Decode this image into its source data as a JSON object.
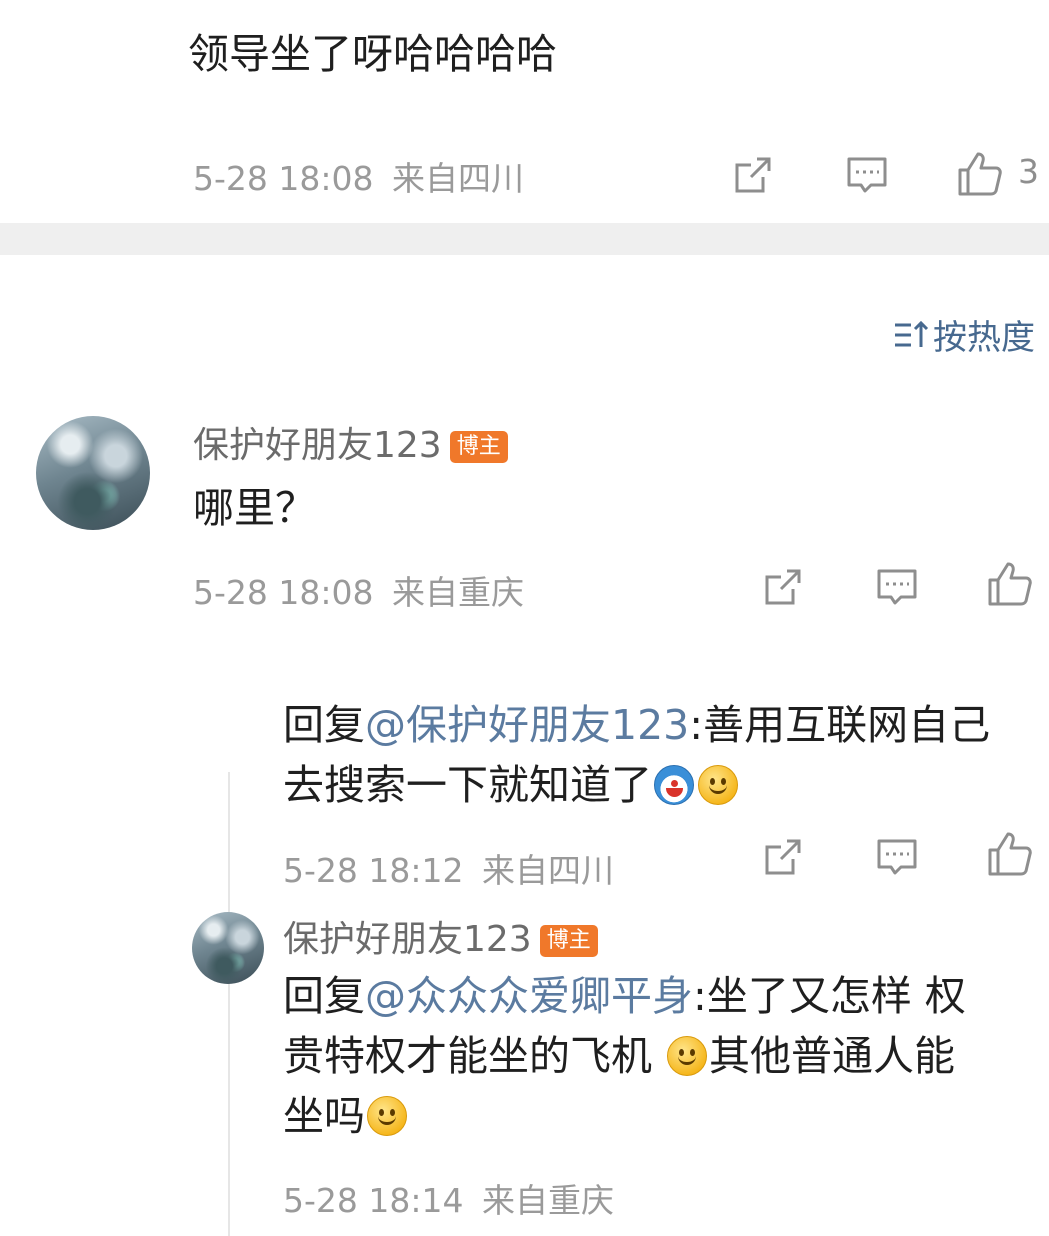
{
  "comment_top": {
    "text": "领导坐了呀哈哈哈哈",
    "date": "5-28 18:08",
    "location": "来自四川",
    "like_count": "3"
  },
  "sort": {
    "icon": "sort-icon",
    "label": "按热度"
  },
  "comment_main": {
    "username": "保护好朋友123",
    "badge": "博主",
    "text": "哪里？",
    "date": "5-28 18:08",
    "location": "来自重庆"
  },
  "reply_1": {
    "prefix": "回复",
    "mention": "@保护好朋友123",
    "line1_rest": ":善用互联网自己",
    "line2": "去搜索一下就知道了",
    "emojis": [
      "doraemon-emoji",
      "smile-emoji"
    ],
    "date": "5-28 18:12",
    "location": "来自四川"
  },
  "reply_2": {
    "username": "保护好朋友123",
    "badge": "博主",
    "prefix": "回复",
    "mention": "@众众众爱卿平身",
    "line1_rest": ":坐了又怎样 权",
    "line2_a": "贵特权才能坐的飞机 ",
    "line2_b": "其他普通人能",
    "line3": "坐吗",
    "emojis": [
      "smile-emoji"
    ],
    "date": "5-28 18:14",
    "location": "来自重庆"
  },
  "icons": {
    "share": "share-icon",
    "comment": "comment-icon",
    "like": "thumbs-up-icon"
  },
  "colors": {
    "mention": "#5b7ba0",
    "badge": "#f0782a",
    "sort": "#47698f",
    "meta": "#9a9a9a",
    "divider": "#efefef"
  }
}
